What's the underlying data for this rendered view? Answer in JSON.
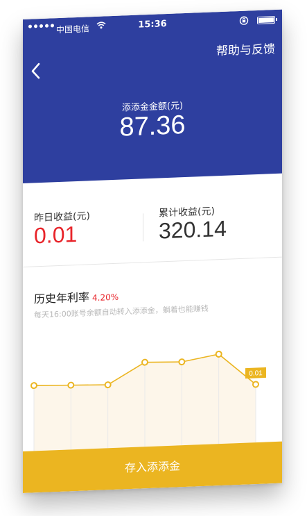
{
  "status_bar": {
    "carrier": "中国电信",
    "time": "15:36",
    "icons": [
      "signal-icon",
      "wifi-icon",
      "orientation-lock-icon",
      "battery-icon"
    ]
  },
  "nav": {
    "back_icon": "back-arrow-icon",
    "help_label": "帮助与反馈"
  },
  "balance": {
    "label": "添添金金额(元)",
    "value": "87.36"
  },
  "earnings": {
    "yesterday_label": "昨日收益(元)",
    "yesterday_value": "0.01",
    "total_label": "累计收益(元)",
    "total_value": "320.14"
  },
  "rate": {
    "label": "历史年利率",
    "value": "4.20%",
    "note": "每天16:00账号余额自动转入添添金，躺着也能赚钱"
  },
  "chart_data": {
    "type": "line",
    "x": [
      1,
      2,
      3,
      4,
      5,
      6,
      7
    ],
    "y": [
      0.62,
      0.61,
      0.6,
      0.8,
      0.79,
      0.85,
      0.55
    ],
    "ylim": [
      0,
      1
    ],
    "point_label": "0.01",
    "grid": "vertical",
    "colors": {
      "line": "#ebb521",
      "area": "#fdf6ea",
      "grid": "#e9e9e9",
      "label_bg": "#ebb521"
    }
  },
  "cta": {
    "label": "存入添添金"
  },
  "colors": {
    "header": "#2e3f9f",
    "accent_red": "#e8242a",
    "accent_yellow": "#ebb521"
  }
}
